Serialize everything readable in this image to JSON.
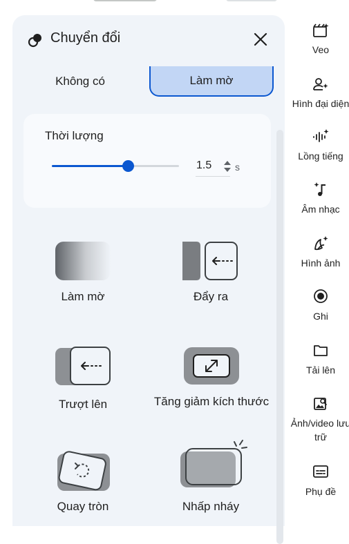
{
  "panel": {
    "title": "Chuyển đổi",
    "close_icon": "close-icon",
    "tabs": [
      {
        "label": "Không có",
        "selected": false
      },
      {
        "label": "Làm mờ",
        "selected": true
      }
    ],
    "duration": {
      "label": "Thời lượng",
      "value": "1.5",
      "unit": "s",
      "slider_fraction": 0.6
    },
    "options": [
      {
        "label": "Làm mờ",
        "icon": "fade-icon"
      },
      {
        "label": "Đẩy ra",
        "icon": "push-icon"
      },
      {
        "label": "Trượt lên",
        "icon": "slide-icon"
      },
      {
        "label": "Tăng giảm kích thước",
        "icon": "scale-icon"
      },
      {
        "label": "Quay tròn",
        "icon": "rotate-icon"
      },
      {
        "label": "Nhấp nháy",
        "icon": "flash-icon"
      }
    ]
  },
  "rail": {
    "items": [
      {
        "label": "Veo",
        "icon": "clapperboard-sparkle-icon"
      },
      {
        "label": "Hình đại diện",
        "icon": "avatar-sparkle-icon"
      },
      {
        "label": "Lồng tiếng",
        "icon": "voice-wave-icon"
      },
      {
        "label": "Âm nhạc",
        "icon": "music-note-icon"
      },
      {
        "label": "Hình ảnh",
        "icon": "banana-sparkle-icon"
      },
      {
        "label": "Ghi",
        "icon": "record-icon"
      },
      {
        "label": "Tải lên",
        "icon": "folder-icon"
      },
      {
        "label": "Ảnh/video lưu trữ",
        "label_line1": "Ảnh/video lưu",
        "label_line2": "trữ",
        "icon": "stock-media-icon"
      },
      {
        "label": "Phụ đề",
        "icon": "subtitles-icon"
      }
    ]
  },
  "colors": {
    "accent": "#0b57d0",
    "selected_tab_bg": "#c2d6f5",
    "panel_bg": "#f0f4f9"
  }
}
